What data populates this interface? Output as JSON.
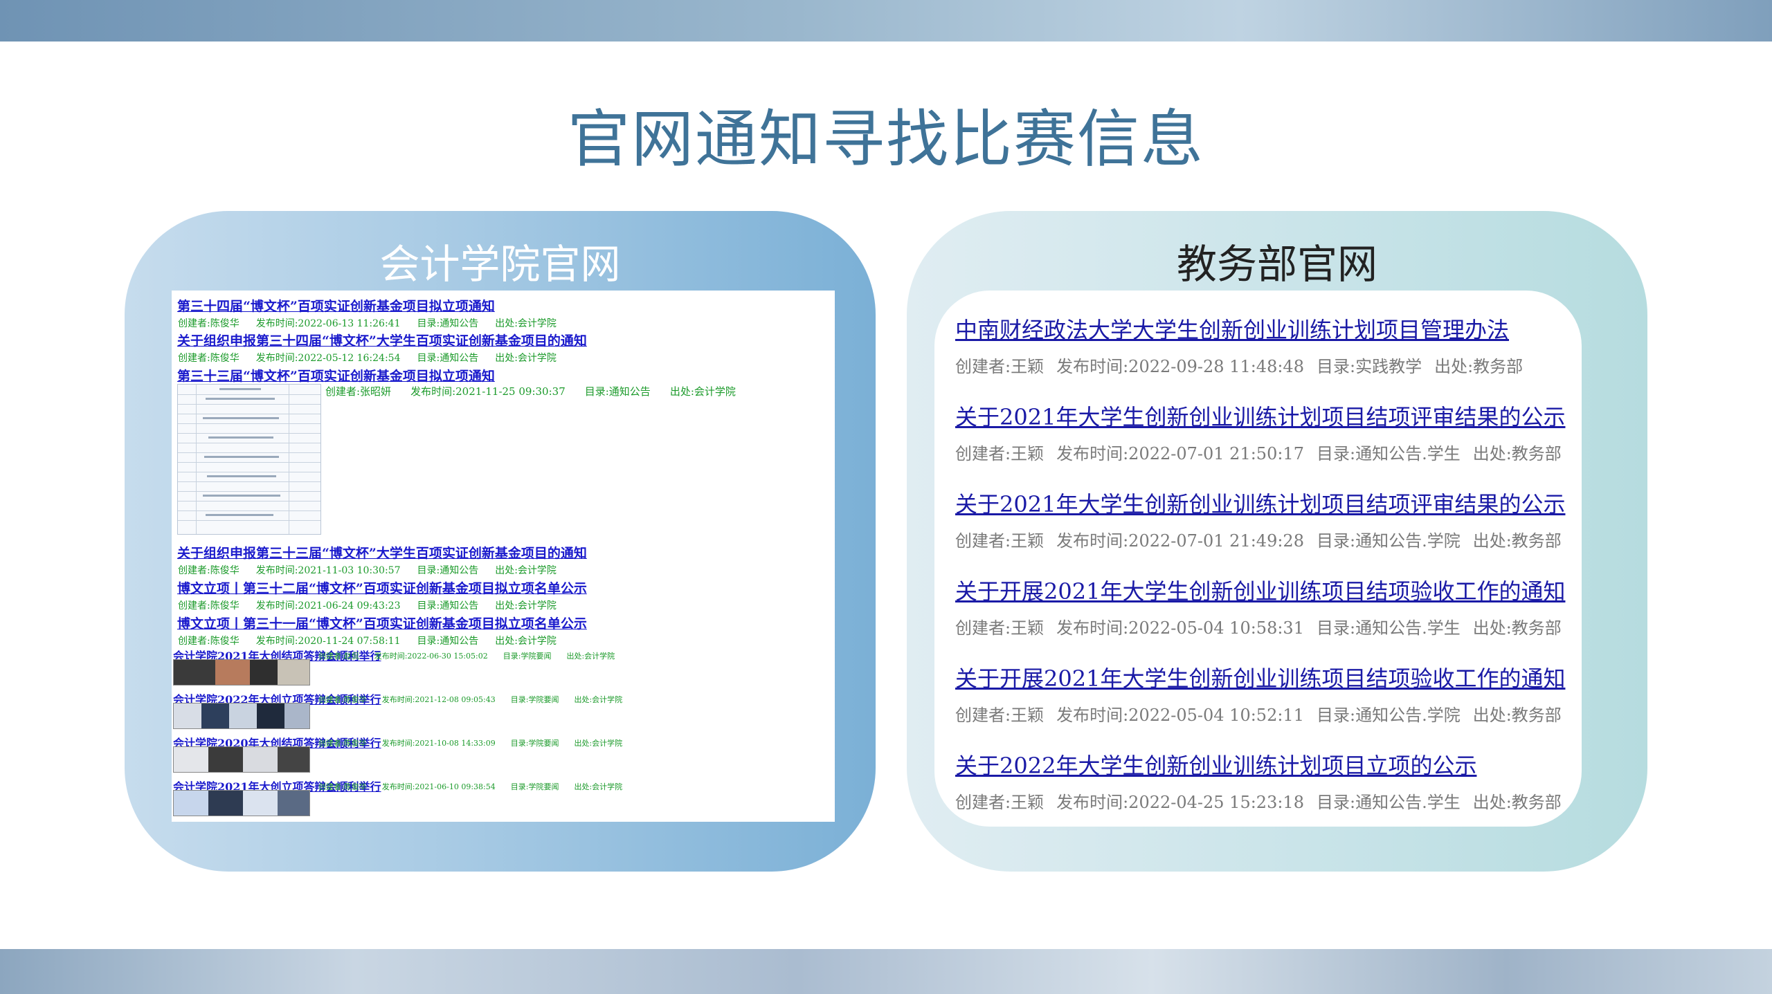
{
  "title": "官网通知寻找比赛信息",
  "left_panel": {
    "heading": "会计学院官网",
    "items": [
      {
        "title": "第三十四届“博文杯”百项实证创新基金项目拟立项通知",
        "creator": "创建者:陈俊华",
        "time": "发布时间:2022-06-13 11:26:41",
        "dir": "目录:通知公告",
        "source": "出处:会计学院"
      },
      {
        "title": "关于组织申报第三十四届“博文杯”大学生百项实证创新基金项目的通知",
        "creator": "创建者:陈俊华",
        "time": "发布时间:2022-05-12 16:24:54",
        "dir": "目录:通知公告",
        "source": "出处:会计学院"
      },
      {
        "title": "第三十三届“博文杯”百项实证创新基金项目拟立项通知",
        "creator": "创建者:张昭妍",
        "time": "发布时间:2021-11-25 09:30:37",
        "dir": "目录:通知公告",
        "source": "出处:会计学院"
      },
      {
        "title": "关于组织申报第三十三届“博文杯”大学生百项实证创新基金项目的通知",
        "creator": "创建者:陈俊华",
        "time": "发布时间:2021-11-03 10:30:57",
        "dir": "目录:通知公告",
        "source": "出处:会计学院"
      },
      {
        "title": "博文立项丨第三十二届“博文杯”百项实证创新基金项目拟立项名单公示",
        "creator": "创建者:陈俊华",
        "time": "发布时间:2021-06-24 09:43:23",
        "dir": "目录:通知公告",
        "source": "出处:会计学院"
      },
      {
        "title": "博文立项丨第三十一届“博文杯”百项实证创新基金项目拟立项名单公示",
        "creator": "创建者:陈俊华",
        "time": "发布时间:2020-11-24 07:58:11",
        "dir": "目录:通知公告",
        "source": "出处:会计学院"
      }
    ],
    "news": [
      {
        "title": "会计学院2021年大创结项答辩会顺利举行",
        "creator": "创建者:赵侃",
        "time": "发布时间:2022-06-30 15:05:02",
        "dir": "目录:学院要闻",
        "source": "出处:会计学院"
      },
      {
        "title": "会计学院2022年大创立项答辩会顺利举行",
        "creator": "创建者:陈俊华",
        "time": "发布时间:2021-12-08 09:05:43",
        "dir": "目录:学院要闻",
        "source": "出处:会计学院"
      },
      {
        "title": "会计学院2020年大创结项答辩会顺利举行",
        "creator": "创建者:陈俊华",
        "time": "发布时间:2021-10-08 14:33:09",
        "dir": "目录:学院要闻",
        "source": "出处:会计学院"
      },
      {
        "title": "会计学院2021年大创立项答辩会顺利举行",
        "creator": "创建者:陈俊华",
        "time": "发布时间:2021-06-10 09:38:54",
        "dir": "目录:学院要闻",
        "source": "出处:会计学院"
      }
    ]
  },
  "right_panel": {
    "heading": "教务部官网",
    "items": [
      {
        "title": "中南财经政法大学大学生创新创业训练计划项目管理办法",
        "creator": "创建者:王颖",
        "time": "发布时间:2022-09-28 11:48:48",
        "dir": "目录:实践教学",
        "source": "出处:教务部"
      },
      {
        "title": "关于2021年大学生创新创业训练计划项目结项评审结果的公示",
        "creator": "创建者:王颖",
        "time": "发布时间:2022-07-01 21:50:17",
        "dir": "目录:通知公告.学生",
        "source": "出处:教务部"
      },
      {
        "title": "关于2021年大学生创新创业训练计划项目结项评审结果的公示",
        "creator": "创建者:王颖",
        "time": "发布时间:2022-07-01 21:49:28",
        "dir": "目录:通知公告.学院",
        "source": "出处:教务部"
      },
      {
        "title": "关于开展2021年大学生创新创业训练项目结项验收工作的通知",
        "creator": "创建者:王颖",
        "time": "发布时间:2022-05-04 10:58:31",
        "dir": "目录:通知公告.学生",
        "source": "出处:教务部"
      },
      {
        "title": "关于开展2021年大学生创新创业训练项目结项验收工作的通知",
        "creator": "创建者:王颖",
        "time": "发布时间:2022-05-04 10:52:11",
        "dir": "目录:通知公告.学院",
        "source": "出处:教务部"
      },
      {
        "title": "关于2022年大学生创新创业训练计划项目立项的公示",
        "creator": "创建者:王颖",
        "time": "发布时间:2022-04-25 15:23:18",
        "dir": "目录:通知公告.学生",
        "source": "出处:教务部"
      }
    ]
  }
}
